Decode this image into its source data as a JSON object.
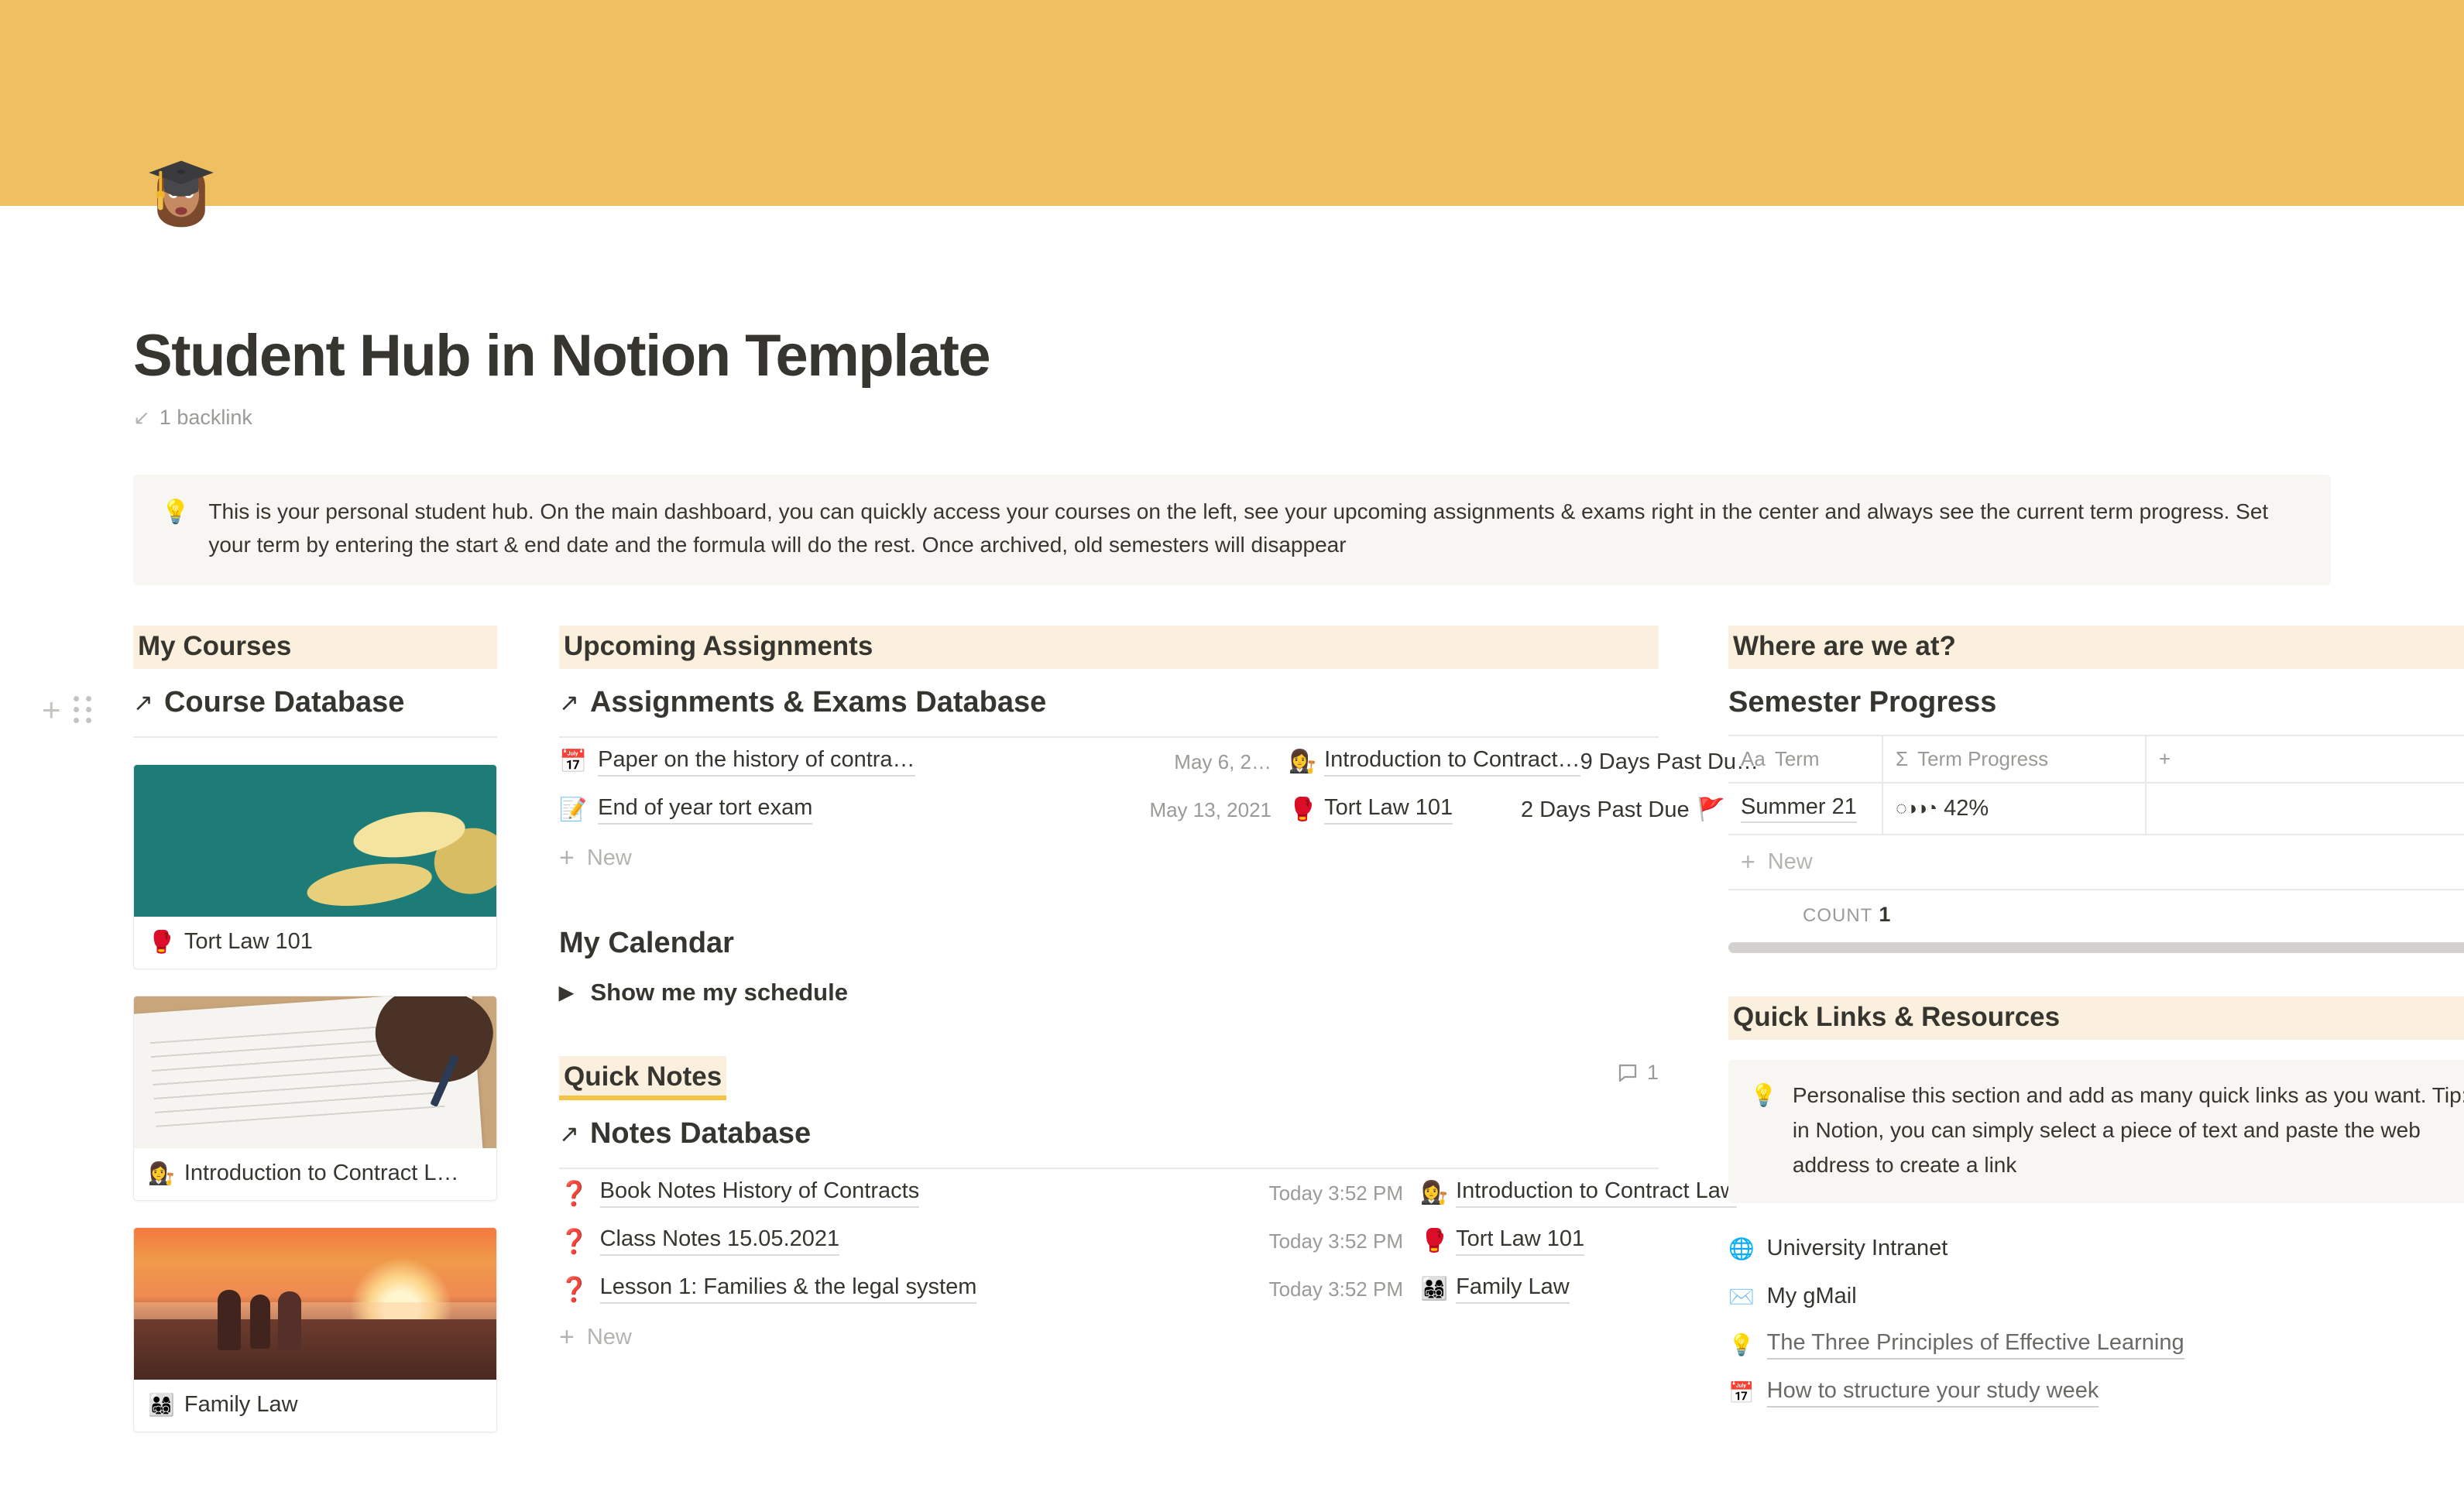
{
  "page": {
    "icon": "🎓👩",
    "title": "Student Hub in Notion Template",
    "backlink": "1 backlink",
    "backlink_icon": "↙",
    "callout": {
      "icon": "💡",
      "text": "This is your personal student hub. On the main dashboard, you can quickly access your courses on the left, see your upcoming assignments & exams right in the center and always see the current term progress. Set your term by entering the start & end date and the formula will do the rest. Once archived, old semesters will disappear"
    }
  },
  "colors": {
    "cover": "#f0bf62",
    "section_highlight": "#faf0dd",
    "underline_accent": "#f5c344",
    "callout_bg": "#f7f6f3",
    "overdue": "#37352f"
  },
  "left_column": {
    "section_title": "My Courses",
    "add_icon": "+",
    "drag_icon": "drag-handle",
    "database_link": "Course Database",
    "link_arrow": "↗",
    "courses": [
      {
        "emoji": "🥊",
        "name": "Tort Law 101",
        "thumb": "banana-teal"
      },
      {
        "emoji": "👩‍⚖️",
        "name": "Introduction to Contract L…",
        "thumb": "contract-signing"
      },
      {
        "emoji": "👨‍👩‍👧‍👦",
        "name": "Family Law",
        "thumb": "family-sunset"
      }
    ]
  },
  "middle_column": {
    "section_title": "Upcoming Assignments",
    "database_link": "Assignments & Exams Database",
    "link_arrow": "↗",
    "assignment_rows": [
      {
        "icon": "📅",
        "title": "Paper on the history of contra…",
        "date": "May 6, 2…",
        "course_emoji": "👩‍⚖️",
        "course": "Introduction to Contract…",
        "status": "9 Days Past Du…",
        "status_emoji": ""
      },
      {
        "icon": "📝",
        "title": "End of year tort exam",
        "date": "May 13, 2021",
        "course_emoji": "🥊",
        "course": "Tort Law 101",
        "status": "2 Days Past Due",
        "status_emoji": "🚩"
      }
    ],
    "new_label": "New",
    "calendar_title": "My Calendar",
    "calendar_toggle": "Show me my schedule",
    "toggle_icon": "▶",
    "notes_title": "Quick Notes",
    "comment_count": "1",
    "notes_database_link": "Notes Database",
    "note_rows": [
      {
        "icon": "❓",
        "title": "Book Notes History of Contracts",
        "date": "Today 3:52 PM",
        "course_emoji": "👩‍⚖️",
        "course": "Introduction to Contract Law"
      },
      {
        "icon": "❓",
        "title": "Class Notes 15.05.2021",
        "date": "Today 3:52 PM",
        "course_emoji": "🥊",
        "course": "Tort Law 101"
      },
      {
        "icon": "❓",
        "title": "Lesson 1: Families & the legal system",
        "date": "Today 3:52 PM",
        "course_emoji": "👨‍👩‍👧‍👦",
        "course": "Family Law"
      }
    ],
    "notes_new_label": "New"
  },
  "right_column": {
    "section_title": "Where are we at?",
    "table_title": "Semester Progress",
    "columns": [
      {
        "icon": "Aa",
        "label": "Term"
      },
      {
        "icon": "Σ",
        "label": "Term Progress"
      },
      {
        "icon": "+",
        "label": ""
      }
    ],
    "rows": [
      {
        "term": "Summer 21",
        "progress_glyphs": "◌◑◑◔",
        "progress": "42%"
      }
    ],
    "new_label": "New",
    "count_label": "COUNT",
    "count_value": "1",
    "quick_links_title": "Quick Links & Resources",
    "quick_links_callout": {
      "icon": "💡",
      "text": "Personalise this section and add as many quick links as you want. Tip: in Notion, you can simply select a piece of text and paste the web address to create a link"
    },
    "quick_links": [
      {
        "icon": "🌐",
        "label": "University Intranet",
        "style": "plain"
      },
      {
        "icon": "✉️",
        "label": "My gMail",
        "style": "plain"
      },
      {
        "icon": "💡",
        "label": "The Three Principles of Effective Learning",
        "style": "link"
      },
      {
        "icon": "📅",
        "label": "How to structure your study week",
        "style": "link"
      }
    ]
  }
}
